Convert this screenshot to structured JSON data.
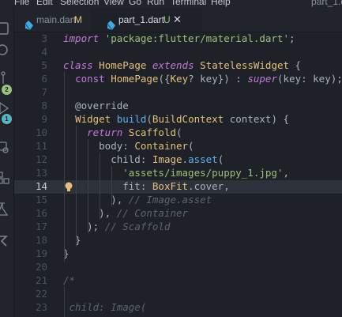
{
  "menu": [
    "File",
    "Edit",
    "Selection",
    "View",
    "Go",
    "Run",
    "Terminal",
    "Help"
  ],
  "window_title": "part_1.dart",
  "activity_badges": [
    "2",
    "1"
  ],
  "tabs": [
    {
      "name": "main.dart",
      "status": "M",
      "active": false
    },
    {
      "name": "part_1.dart",
      "status": "U",
      "active": true
    }
  ],
  "current_line": "14",
  "lines": [
    {
      "n": "3",
      "tokens": [
        [
          "kwi",
          "import"
        ],
        [
          "punc",
          " "
        ],
        [
          "str",
          "'package:flutter/material.dart'"
        ],
        [
          "punc",
          ";"
        ]
      ]
    },
    {
      "n": "4",
      "tokens": []
    },
    {
      "n": "5",
      "tokens": [
        [
          "kwi",
          "class"
        ],
        [
          "punc",
          " "
        ],
        [
          "cls",
          "HomePage"
        ],
        [
          "punc",
          " "
        ],
        [
          "kwi",
          "extends"
        ],
        [
          "punc",
          " "
        ],
        [
          "cls",
          "StatelessWidget"
        ],
        [
          "punc",
          " {"
        ]
      ]
    },
    {
      "n": "6",
      "tokens": [
        [
          "punc",
          "  "
        ],
        [
          "kw",
          "const"
        ],
        [
          "punc",
          " "
        ],
        [
          "cls",
          "HomePage"
        ],
        [
          "punc",
          "({"
        ],
        [
          "cls",
          "Key"
        ],
        [
          "punc",
          "? key}) : "
        ],
        [
          "kwi",
          "super"
        ],
        [
          "punc",
          "(key: key);"
        ]
      ]
    },
    {
      "n": "7",
      "tokens": []
    },
    {
      "n": "8",
      "tokens": [
        [
          "punc",
          "  @override"
        ]
      ]
    },
    {
      "n": "9",
      "tokens": [
        [
          "punc",
          "  "
        ],
        [
          "cls",
          "Widget"
        ],
        [
          "punc",
          " "
        ],
        [
          "fn",
          "build"
        ],
        [
          "punc",
          "("
        ],
        [
          "cls",
          "BuildContext"
        ],
        [
          "punc",
          " context) {"
        ]
      ]
    },
    {
      "n": "10",
      "tokens": [
        [
          "punc",
          "    "
        ],
        [
          "kwi",
          "return"
        ],
        [
          "punc",
          " "
        ],
        [
          "cls",
          "Scaffold"
        ],
        [
          "punc",
          "("
        ]
      ]
    },
    {
      "n": "11",
      "tokens": [
        [
          "punc",
          "      body: "
        ],
        [
          "cls",
          "Container"
        ],
        [
          "punc",
          "("
        ]
      ]
    },
    {
      "n": "12",
      "tokens": [
        [
          "punc",
          "        child: "
        ],
        [
          "cls",
          "Image"
        ],
        [
          "punc",
          "."
        ],
        [
          "fn",
          "asset"
        ],
        [
          "punc",
          "("
        ]
      ]
    },
    {
      "n": "13",
      "tokens": [
        [
          "punc",
          "          "
        ],
        [
          "str",
          "'assets/images/puppy_1.jpg'"
        ],
        [
          "punc",
          ","
        ]
      ]
    },
    {
      "n": "14",
      "tokens": [
        [
          "punc",
          "          fit: "
        ],
        [
          "cls",
          "BoxFit"
        ],
        [
          "punc",
          ".cover,"
        ]
      ]
    },
    {
      "n": "15",
      "tokens": [
        [
          "punc",
          "        ), "
        ],
        [
          "cmt",
          "// Image.asset"
        ]
      ]
    },
    {
      "n": "16",
      "tokens": [
        [
          "punc",
          "      ), "
        ],
        [
          "cmt",
          "// Container"
        ]
      ]
    },
    {
      "n": "17",
      "tokens": [
        [
          "punc",
          "    ); "
        ],
        [
          "cmt",
          "// Scaffold"
        ]
      ]
    },
    {
      "n": "18",
      "tokens": [
        [
          "punc",
          "  }"
        ]
      ]
    },
    {
      "n": "19",
      "tokens": [
        [
          "punc",
          "}"
        ]
      ]
    },
    {
      "n": "20",
      "tokens": []
    },
    {
      "n": "21",
      "tokens": [
        [
          "cmt",
          "/*"
        ]
      ]
    },
    {
      "n": "22",
      "tokens": []
    },
    {
      "n": "23",
      "tokens": [
        [
          "cmt",
          " child: Image("
        ]
      ]
    }
  ]
}
